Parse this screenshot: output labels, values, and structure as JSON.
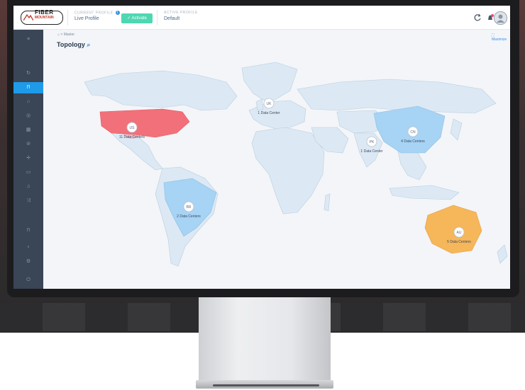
{
  "app": {
    "logo": {
      "name": "FIBER",
      "sub": "MOUNTAIN"
    },
    "current_profile": {
      "label": "CURRENT PROFILE",
      "value": "Live Profile",
      "info": "i"
    },
    "activate_label": "✓ Activate",
    "active_profile": {
      "label": "ACTIVE PROFILE",
      "value": "Default"
    }
  },
  "breadcrumb": {
    "home_icon": "home-icon",
    "sep": ">",
    "current": "Master"
  },
  "page": {
    "title": "Topology",
    "search_icon": "search-icon",
    "maximize": "Maximize"
  },
  "sidebar": {
    "items": [
      {
        "name": "menu-icon",
        "glyph": "≡",
        "active": false
      },
      {
        "name": "refresh-icon",
        "glyph": "↻",
        "active": false
      },
      {
        "name": "topology-icon",
        "glyph": "⊓",
        "active": true
      },
      {
        "name": "briefcase-icon",
        "glyph": "⌂",
        "active": false
      },
      {
        "name": "database-icon",
        "glyph": "◎",
        "active": false
      },
      {
        "name": "grid-icon",
        "glyph": "▦",
        "active": false
      },
      {
        "name": "compass-icon",
        "glyph": "⊘",
        "active": false
      },
      {
        "name": "network-icon",
        "glyph": "✛",
        "active": false
      },
      {
        "name": "monitor-icon",
        "glyph": "▭",
        "active": false
      },
      {
        "name": "bell-icon",
        "glyph": "♫",
        "active": false
      },
      {
        "name": "shuffle-icon",
        "glyph": "⤨",
        "active": false
      },
      {
        "name": "lock-icon",
        "glyph": "⊓",
        "active": false
      },
      {
        "name": "user-icon",
        "glyph": "♀",
        "active": false
      },
      {
        "name": "settings-icon",
        "glyph": "⚙",
        "active": false
      },
      {
        "name": "power-icon",
        "glyph": "⏻",
        "active": false
      }
    ]
  },
  "markers": [
    {
      "code": "US",
      "label": "11 Data Centers",
      "color": "#f0707a"
    },
    {
      "code": "UK",
      "label": "1 Data Center",
      "color": "#ffffff"
    },
    {
      "code": "PK",
      "label": "1 Data Center",
      "color": "#ffffff"
    },
    {
      "code": "CN",
      "label": "4 Data Centers",
      "color": "#a8d4f5"
    },
    {
      "code": "BR",
      "label": "2 Data Centers",
      "color": "#a8d4f5"
    },
    {
      "code": "AU",
      "label": "5 Data Centers",
      "color": "#f6b65a"
    }
  ]
}
